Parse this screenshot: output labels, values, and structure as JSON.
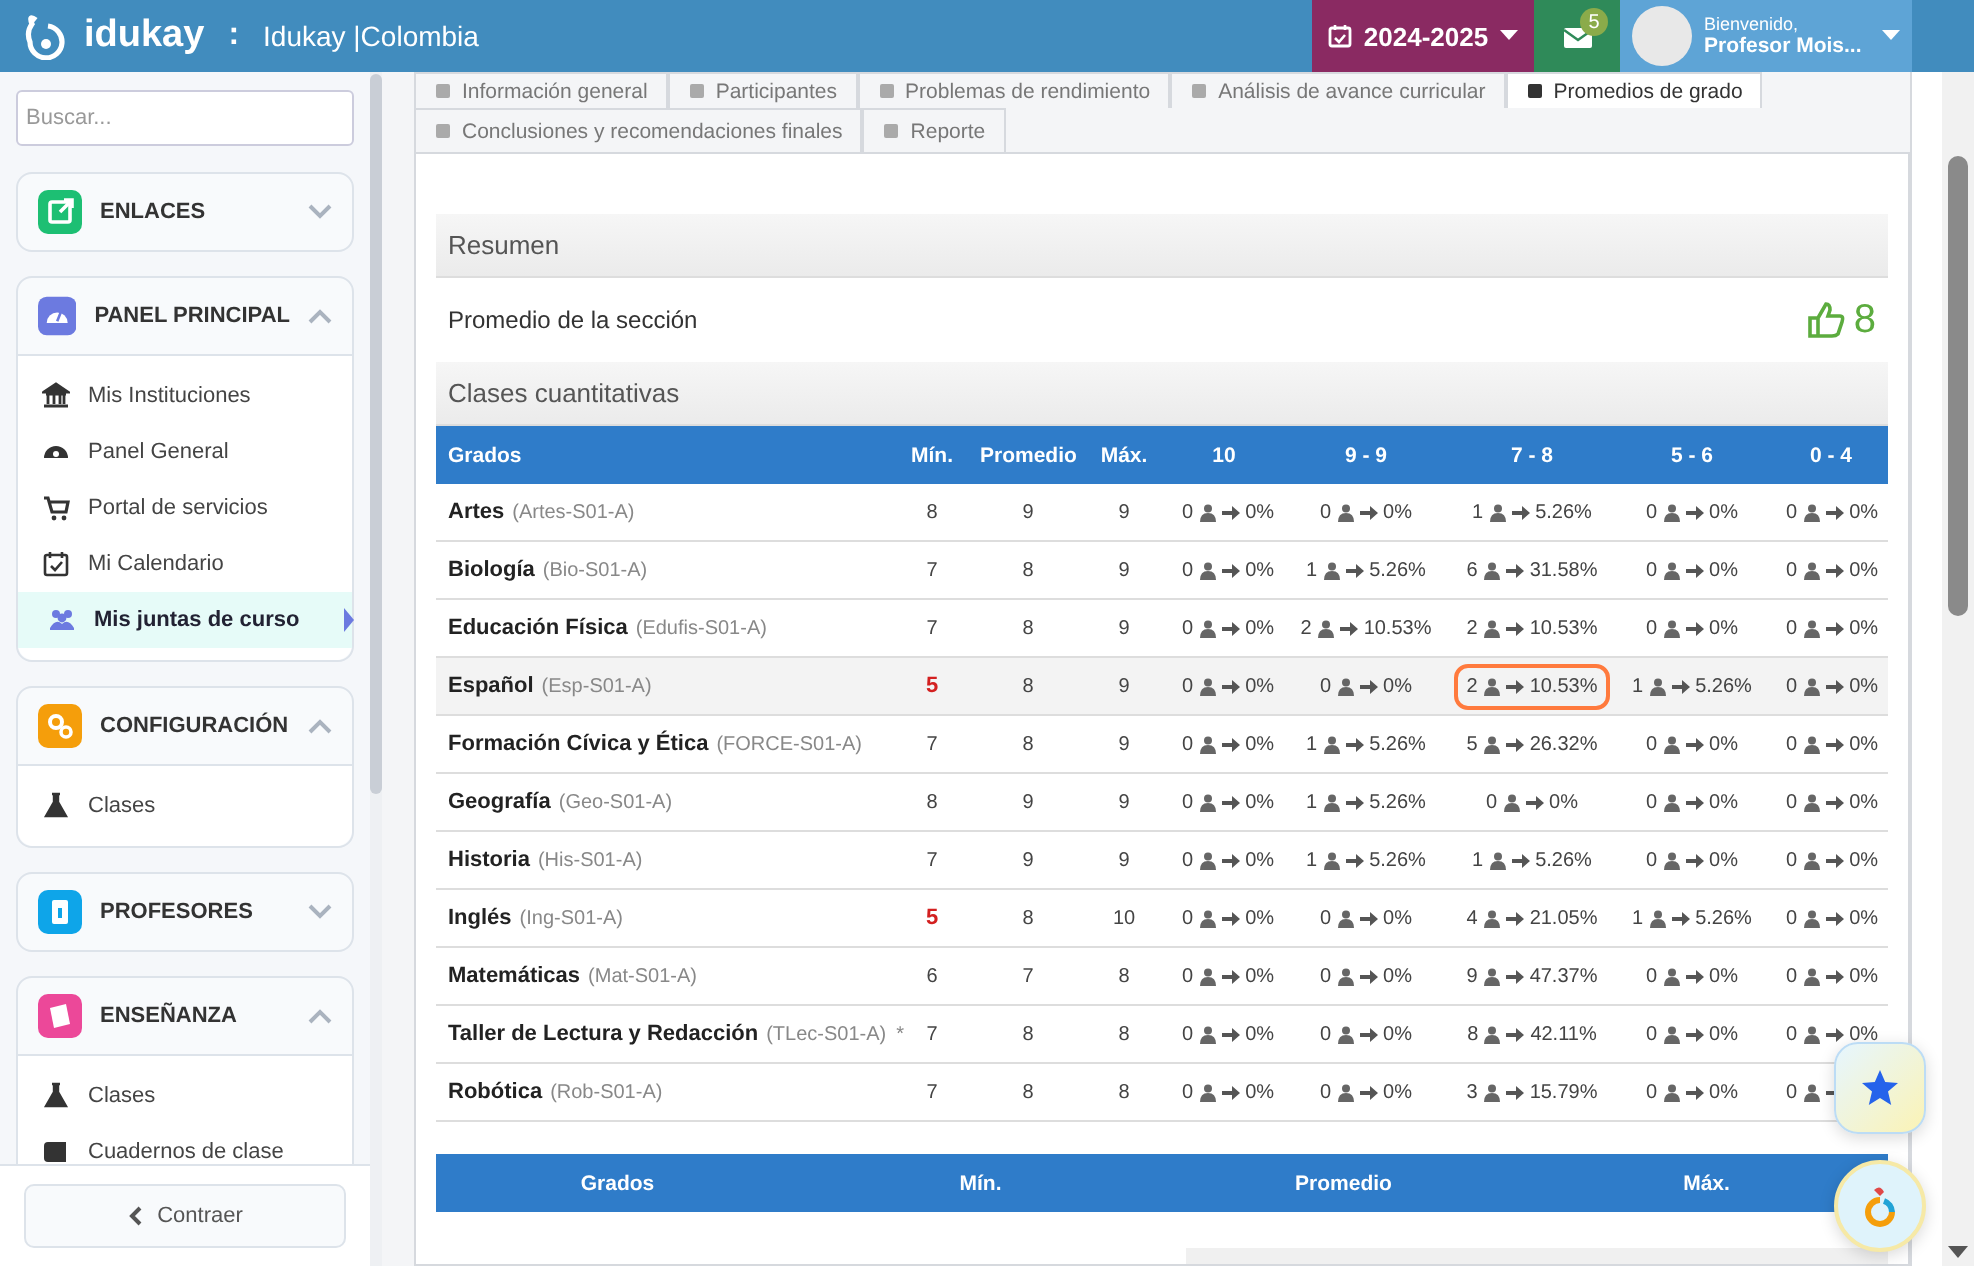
{
  "header": {
    "brand": "idukay",
    "separator": ":",
    "site": "Idukay |Colombia",
    "year": "2024-2025",
    "messages_badge": "5",
    "greeting": "Bienvenido,",
    "user": "Profesor Mois..."
  },
  "sidebar": {
    "search": {
      "placeholder": "Buscar..."
    },
    "sections": [
      {
        "title": "ENLACES",
        "color": "#1dbf73",
        "expanded": false
      },
      {
        "title": "PANEL PRINCIPAL",
        "color": "#6c7ae0",
        "expanded": true,
        "items": [
          {
            "label": "Mis Instituciones",
            "selected": false
          },
          {
            "label": "Panel General",
            "selected": false
          },
          {
            "label": "Portal de servicios",
            "selected": false
          },
          {
            "label": "Mi Calendario",
            "selected": false
          },
          {
            "label": "Mis juntas de curso",
            "selected": true
          }
        ]
      },
      {
        "title": "CONFIGURACIÓN",
        "color": "#f59e0b",
        "expanded": true,
        "items": [
          {
            "label": "Clases",
            "selected": false
          }
        ]
      },
      {
        "title": "PROFESORES",
        "color": "#0ea5e9",
        "expanded": false
      },
      {
        "title": "ENSEÑANZA",
        "color": "#ec4899",
        "expanded": true,
        "items": [
          {
            "label": "Clases",
            "selected": false
          },
          {
            "label": "Cuadernos de clase",
            "selected": false
          }
        ]
      }
    ],
    "collapse_button": "Contraer"
  },
  "tabs": [
    [
      {
        "label": "Información general",
        "selected": false
      },
      {
        "label": "Participantes",
        "selected": false
      },
      {
        "label": "Problemas de rendimiento",
        "selected": false
      },
      {
        "label": "Análisis de avance curricular",
        "selected": false
      },
      {
        "label": "Promedios de grado",
        "selected": true
      }
    ],
    [
      {
        "label": "Conclusiones y recomendaciones finales",
        "selected": false
      },
      {
        "label": "Reporte",
        "selected": false
      }
    ]
  ],
  "summary": {
    "title": "Resumen",
    "label": "Promedio de la sección",
    "value": "8"
  },
  "quantitative": {
    "title": "Clases cuantitativas",
    "columns": [
      "Grados",
      "Mín.",
      "Promedio",
      "Máx."
    ],
    "range_columns": [
      "10",
      "9 - 9",
      "7 - 8",
      "5 - 6",
      "0 - 4"
    ],
    "rows": [
      {
        "name": "Artes",
        "code": "(Artes-S01-A)",
        "note": "",
        "min": "8",
        "min_alert": false,
        "avg": "9",
        "max": "9",
        "hovered": false,
        "cells": [
          {
            "count": "0",
            "percent": "0%",
            "highlighted": false
          },
          {
            "count": "0",
            "percent": "0%",
            "highlighted": false
          },
          {
            "count": "1",
            "percent": "5.26%",
            "highlighted": false
          },
          {
            "count": "0",
            "percent": "0%",
            "highlighted": false
          },
          {
            "count": "0",
            "percent": "0%",
            "highlighted": false
          }
        ]
      },
      {
        "name": "Biología",
        "code": "(Bio-S01-A)",
        "note": "",
        "min": "7",
        "min_alert": false,
        "avg": "8",
        "max": "9",
        "hovered": false,
        "cells": [
          {
            "count": "0",
            "percent": "0%",
            "highlighted": false
          },
          {
            "count": "1",
            "percent": "5.26%",
            "highlighted": false
          },
          {
            "count": "6",
            "percent": "31.58%",
            "highlighted": false
          },
          {
            "count": "0",
            "percent": "0%",
            "highlighted": false
          },
          {
            "count": "0",
            "percent": "0%",
            "highlighted": false
          }
        ]
      },
      {
        "name": "Educación Física",
        "code": "(Edufis-S01-A)",
        "note": "",
        "min": "7",
        "min_alert": false,
        "avg": "8",
        "max": "9",
        "hovered": false,
        "cells": [
          {
            "count": "0",
            "percent": "0%",
            "highlighted": false
          },
          {
            "count": "2",
            "percent": "10.53%",
            "highlighted": false
          },
          {
            "count": "2",
            "percent": "10.53%",
            "highlighted": false
          },
          {
            "count": "0",
            "percent": "0%",
            "highlighted": false
          },
          {
            "count": "0",
            "percent": "0%",
            "highlighted": false
          }
        ]
      },
      {
        "name": "Español",
        "code": "(Esp-S01-A)",
        "note": "",
        "min": "5",
        "min_alert": true,
        "avg": "8",
        "max": "9",
        "hovered": true,
        "cells": [
          {
            "count": "0",
            "percent": "0%",
            "highlighted": false
          },
          {
            "count": "0",
            "percent": "0%",
            "highlighted": false
          },
          {
            "count": "2",
            "percent": "10.53%",
            "highlighted": true
          },
          {
            "count": "1",
            "percent": "5.26%",
            "highlighted": false
          },
          {
            "count": "0",
            "percent": "0%",
            "highlighted": false
          }
        ]
      },
      {
        "name": "Formación Cívica y Ética",
        "code": "(FORCE-S01-A)",
        "note": "",
        "min": "7",
        "min_alert": false,
        "avg": "8",
        "max": "9",
        "hovered": false,
        "cells": [
          {
            "count": "0",
            "percent": "0%",
            "highlighted": false
          },
          {
            "count": "1",
            "percent": "5.26%",
            "highlighted": false
          },
          {
            "count": "5",
            "percent": "26.32%",
            "highlighted": false
          },
          {
            "count": "0",
            "percent": "0%",
            "highlighted": false
          },
          {
            "count": "0",
            "percent": "0%",
            "highlighted": false
          }
        ]
      },
      {
        "name": "Geografía",
        "code": "(Geo-S01-A)",
        "note": "",
        "min": "8",
        "min_alert": false,
        "avg": "9",
        "max": "9",
        "hovered": false,
        "cells": [
          {
            "count": "0",
            "percent": "0%",
            "highlighted": false
          },
          {
            "count": "1",
            "percent": "5.26%",
            "highlighted": false
          },
          {
            "count": "0",
            "percent": "0%",
            "highlighted": false
          },
          {
            "count": "0",
            "percent": "0%",
            "highlighted": false
          },
          {
            "count": "0",
            "percent": "0%",
            "highlighted": false
          }
        ]
      },
      {
        "name": "Historia",
        "code": "(His-S01-A)",
        "note": "",
        "min": "7",
        "min_alert": false,
        "avg": "9",
        "max": "9",
        "hovered": false,
        "cells": [
          {
            "count": "0",
            "percent": "0%",
            "highlighted": false
          },
          {
            "count": "1",
            "percent": "5.26%",
            "highlighted": false
          },
          {
            "count": "1",
            "percent": "5.26%",
            "highlighted": false
          },
          {
            "count": "0",
            "percent": "0%",
            "highlighted": false
          },
          {
            "count": "0",
            "percent": "0%",
            "highlighted": false
          }
        ]
      },
      {
        "name": "Inglés",
        "code": "(Ing-S01-A)",
        "note": "",
        "min": "5",
        "min_alert": true,
        "avg": "8",
        "max": "10",
        "hovered": false,
        "cells": [
          {
            "count": "0",
            "percent": "0%",
            "highlighted": false
          },
          {
            "count": "0",
            "percent": "0%",
            "highlighted": false
          },
          {
            "count": "4",
            "percent": "21.05%",
            "highlighted": false
          },
          {
            "count": "1",
            "percent": "5.26%",
            "highlighted": false
          },
          {
            "count": "0",
            "percent": "0%",
            "highlighted": false
          }
        ]
      },
      {
        "name": "Matemáticas",
        "code": "(Mat-S01-A)",
        "note": "",
        "min": "6",
        "min_alert": false,
        "avg": "7",
        "max": "8",
        "hovered": false,
        "cells": [
          {
            "count": "0",
            "percent": "0%",
            "highlighted": false
          },
          {
            "count": "0",
            "percent": "0%",
            "highlighted": false
          },
          {
            "count": "9",
            "percent": "47.37%",
            "highlighted": false
          },
          {
            "count": "0",
            "percent": "0%",
            "highlighted": false
          },
          {
            "count": "0",
            "percent": "0%",
            "highlighted": false
          }
        ]
      },
      {
        "name": "Taller de Lectura y Redacción",
        "code": "(TLec-S01-A)",
        "note": "*",
        "min": "7",
        "min_alert": false,
        "avg": "8",
        "max": "8",
        "hovered": false,
        "cells": [
          {
            "count": "0",
            "percent": "0%",
            "highlighted": false
          },
          {
            "count": "0",
            "percent": "0%",
            "highlighted": false
          },
          {
            "count": "8",
            "percent": "42.11%",
            "highlighted": false
          },
          {
            "count": "0",
            "percent": "0%",
            "highlighted": false
          },
          {
            "count": "0",
            "percent": "0%",
            "highlighted": false
          }
        ]
      },
      {
        "name": "Robótica",
        "code": "(Rob-S01-A)",
        "note": "",
        "min": "7",
        "min_alert": false,
        "avg": "8",
        "max": "8",
        "hovered": false,
        "cells": [
          {
            "count": "0",
            "percent": "0%",
            "highlighted": false
          },
          {
            "count": "0",
            "percent": "0%",
            "highlighted": false
          },
          {
            "count": "3",
            "percent": "15.79%",
            "highlighted": false
          },
          {
            "count": "0",
            "percent": "0%",
            "highlighted": false
          },
          {
            "count": "0",
            "highlighted": false
          }
        ]
      }
    ]
  },
  "second_table": {
    "columns": [
      "Grados",
      "Mín.",
      "Promedio",
      "Máx."
    ]
  }
}
